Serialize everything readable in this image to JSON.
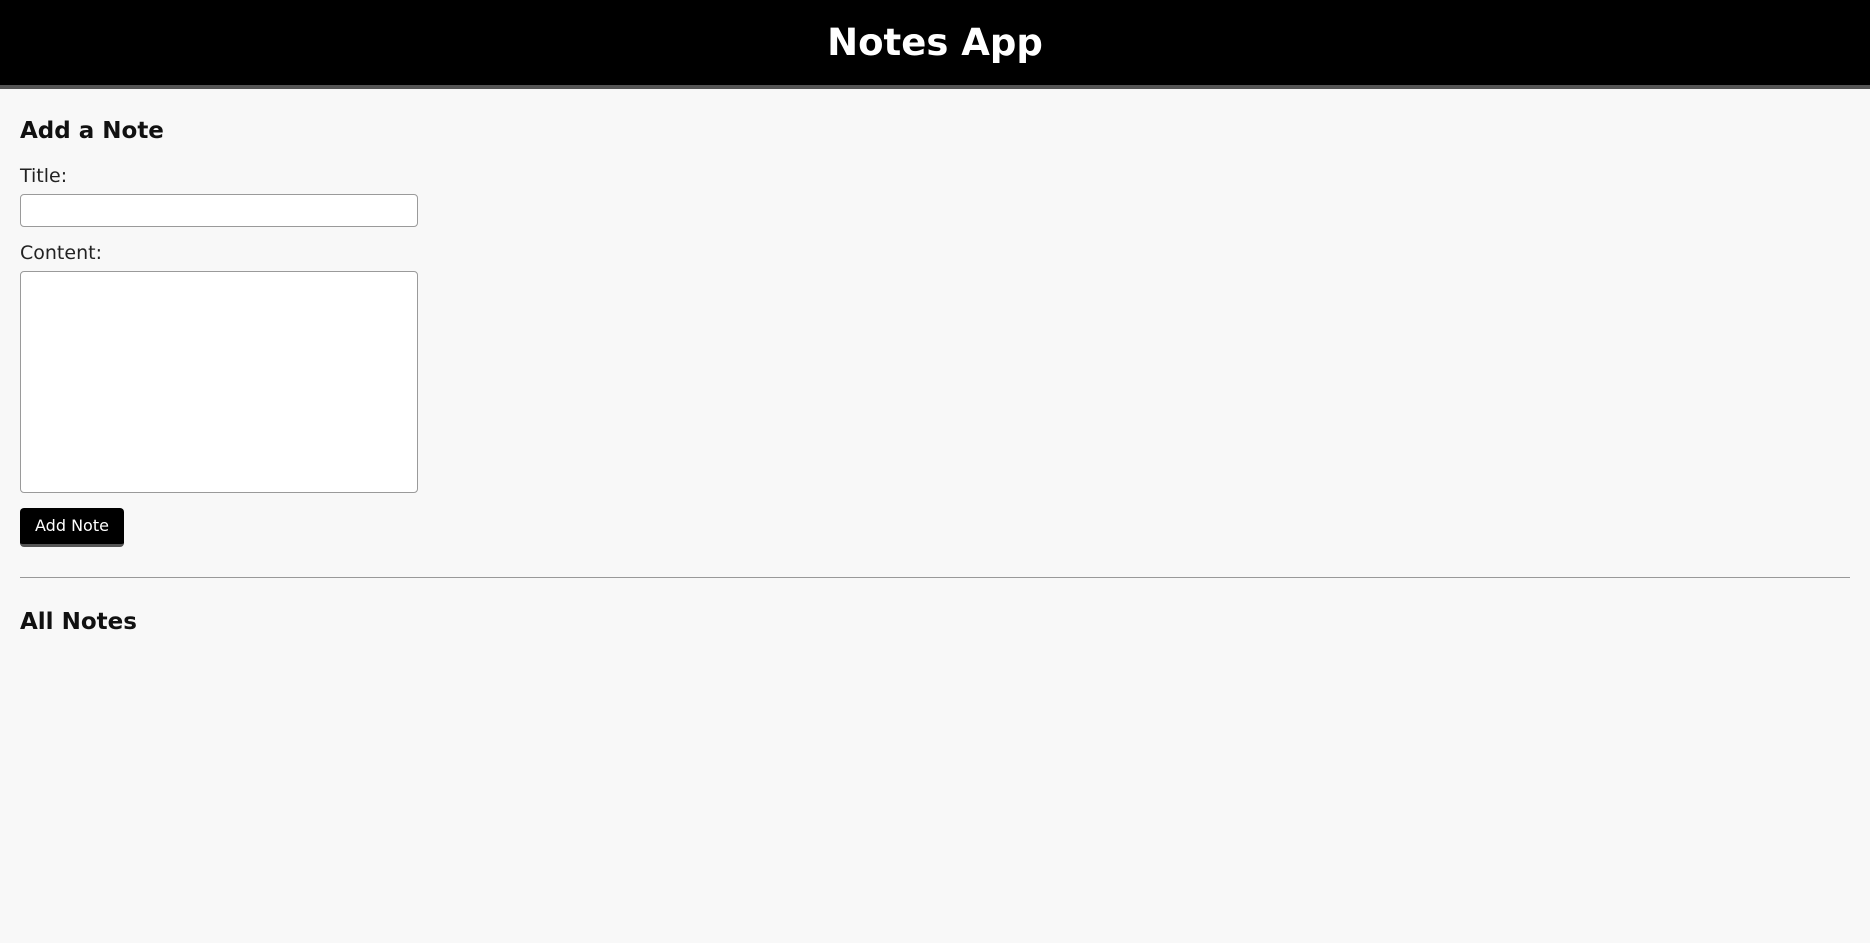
{
  "header": {
    "title": "Notes App"
  },
  "add_note": {
    "heading": "Add a Note",
    "title_label": "Title:",
    "title_value": "",
    "title_placeholder": "",
    "content_label": "Content:",
    "content_value": "",
    "content_placeholder": "",
    "button_label": "Add Note"
  },
  "all_notes": {
    "heading": "All Notes",
    "notes": []
  },
  "colors": {
    "header_background": "#000000",
    "page_background": "#f8f8f8",
    "button_background": "#000000",
    "button_text": "#ffffff"
  }
}
